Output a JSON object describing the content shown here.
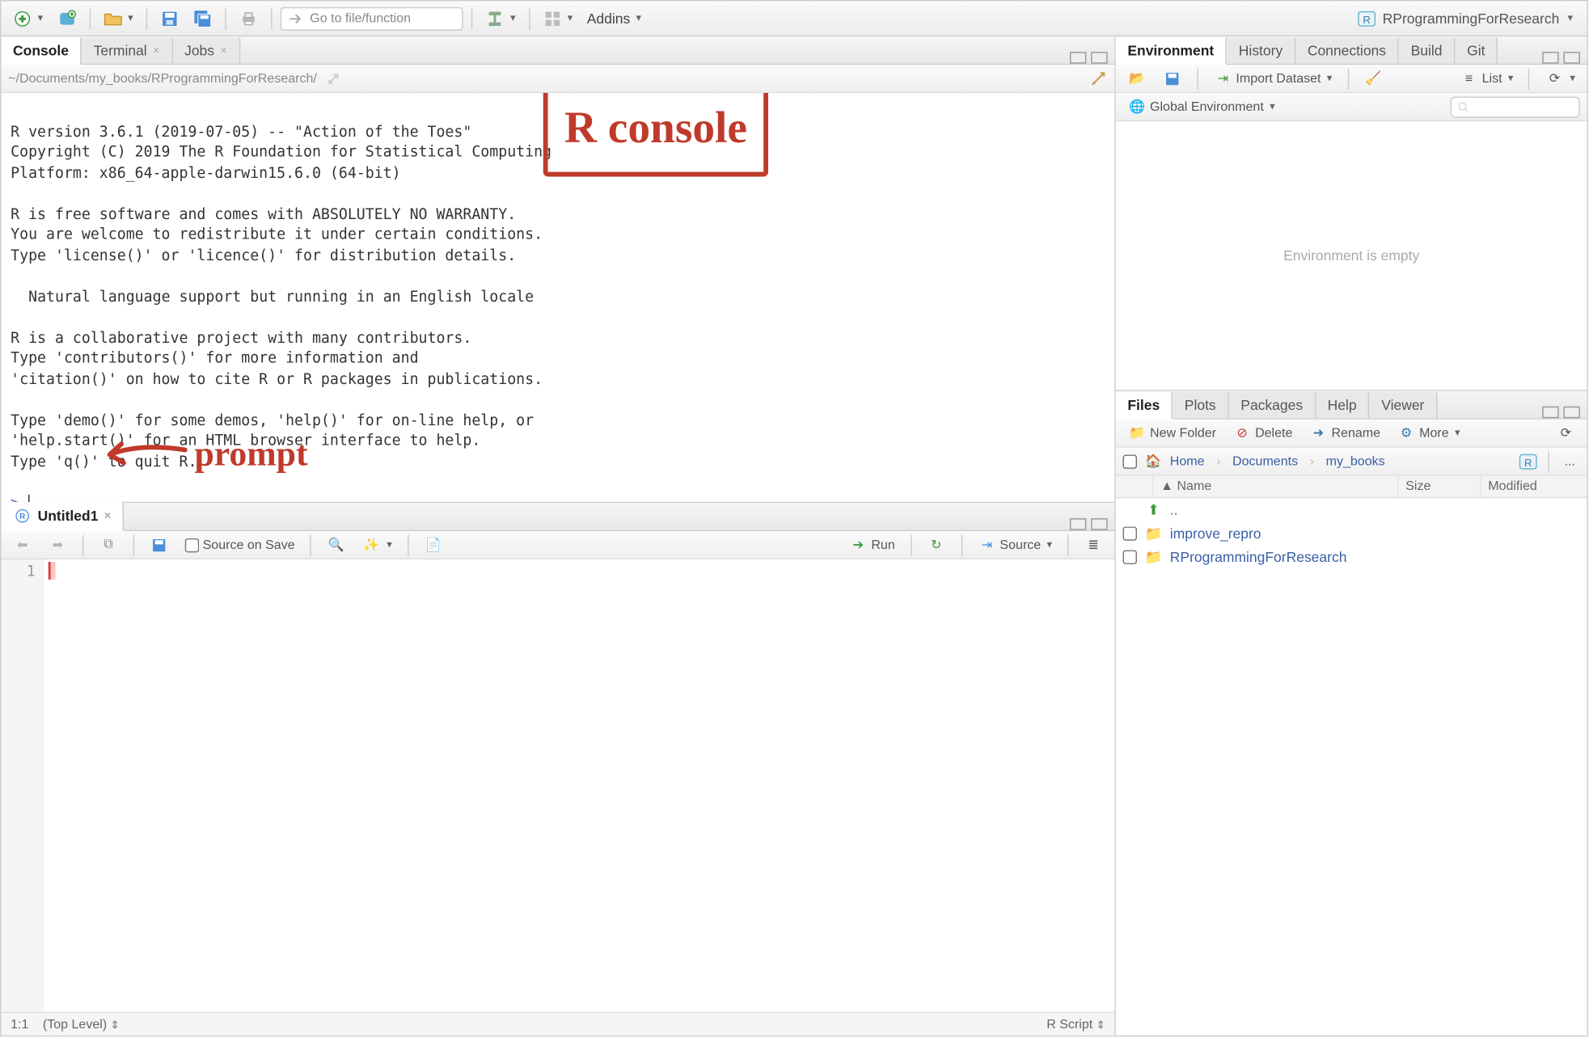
{
  "toolbar": {
    "goto_placeholder": "Go to file/function",
    "addins_label": "Addins",
    "project_name": "RProgrammingForResearch"
  },
  "left": {
    "console": {
      "tabs": [
        {
          "label": "Console",
          "closable": false,
          "active": true
        },
        {
          "label": "Terminal",
          "closable": true,
          "active": false
        },
        {
          "label": "Jobs",
          "closable": true,
          "active": false
        }
      ],
      "path": "~/Documents/my_books/RProgrammingForResearch/",
      "text": "R version 3.6.1 (2019-07-05) -- \"Action of the Toes\"\nCopyright (C) 2019 The R Foundation for Statistical Computing\nPlatform: x86_64-apple-darwin15.6.0 (64-bit)\n\nR is free software and comes with ABSOLUTELY NO WARRANTY.\nYou are welcome to redistribute it under certain conditions.\nType 'license()' or 'licence()' for distribution details.\n\n  Natural language support but running in an English locale\n\nR is a collaborative project with many contributors.\nType 'contributors()' for more information and\n'citation()' on how to cite R or R packages in publications.\n\nType 'demo()' for some demos, 'help()' for on-line help, or\n'help.start()' for an HTML browser interface to help.\nType 'q()' to quit R.\n",
      "prompt": ">"
    },
    "source": {
      "tab_label": "Untitled1",
      "source_on_save": "Source on Save",
      "run_label": "Run",
      "source_label": "Source",
      "line_number": "1",
      "status_pos": "1:1",
      "status_scope": "(Top Level)",
      "status_type": "R Script"
    }
  },
  "right": {
    "env": {
      "tabs": [
        {
          "label": "Environment",
          "active": true
        },
        {
          "label": "History",
          "active": false
        },
        {
          "label": "Connections",
          "active": false
        },
        {
          "label": "Build",
          "active": false
        },
        {
          "label": "Git",
          "active": false
        }
      ],
      "import_label": "Import Dataset",
      "list_label": "List",
      "scope_label": "Global Environment",
      "empty_msg": "Environment is empty"
    },
    "files": {
      "tabs": [
        {
          "label": "Files",
          "active": true
        },
        {
          "label": "Plots",
          "active": false
        },
        {
          "label": "Packages",
          "active": false
        },
        {
          "label": "Help",
          "active": false
        },
        {
          "label": "Viewer",
          "active": false
        }
      ],
      "btn_newfolder": "New Folder",
      "btn_delete": "Delete",
      "btn_rename": "Rename",
      "btn_more": "More",
      "breadcrumb": [
        "Home",
        "Documents",
        "my_books"
      ],
      "head_name": "Name",
      "head_size": "Size",
      "head_modified": "Modified",
      "rows": [
        {
          "name": "..",
          "up": true
        },
        {
          "name": "improve_repro",
          "folder": true
        },
        {
          "name": "RProgrammingForResearch",
          "folder": true
        }
      ],
      "dots": "..."
    }
  },
  "annotations": {
    "console_box": "R console",
    "prompt_label": "prompt"
  }
}
